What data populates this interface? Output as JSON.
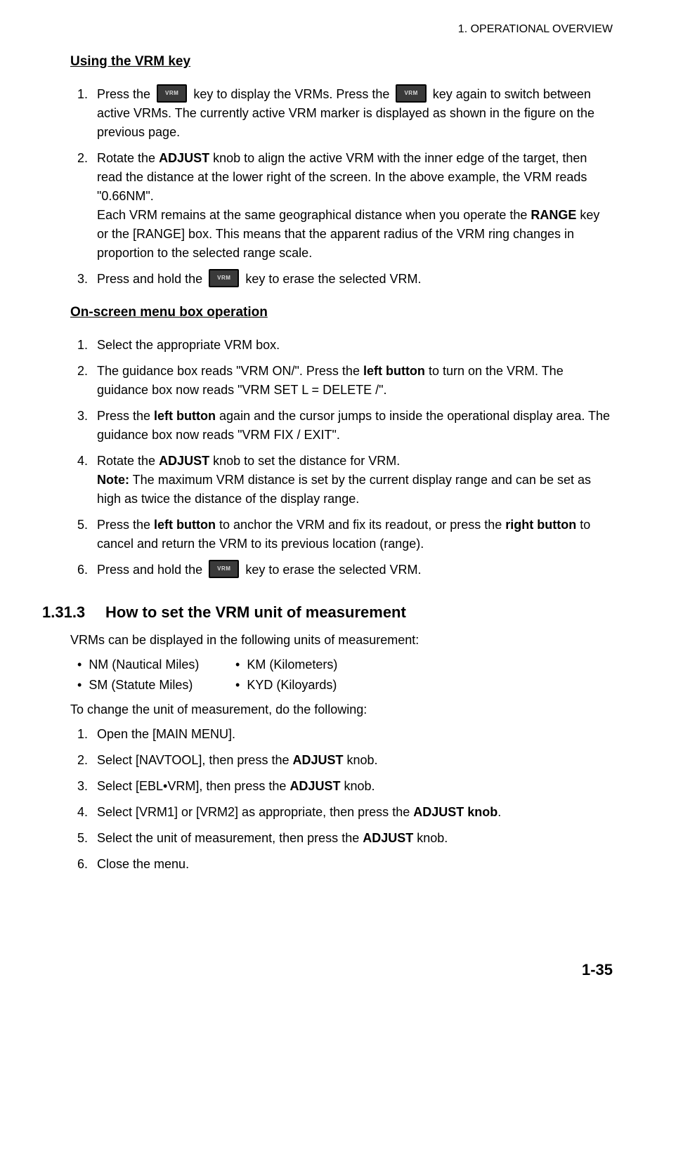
{
  "header": "1.  OPERATIONAL OVERVIEW",
  "section1_title": "Using the VRM key",
  "vrm_label": "VRM",
  "s1_1_a": "Press the ",
  "s1_1_b": " key to display the VRMs. Press the ",
  "s1_1_c": " key again to switch between active VRMs. The currently active VRM marker is displayed as shown in the figure on the previous page.",
  "s1_2_a": "Rotate the ",
  "s1_2_bold1": "ADJUST",
  "s1_2_b": " knob to align the active VRM with the inner edge of the target, then read the distance at the lower right of the screen. In the above example, the VRM reads \"0.66NM\".",
  "s1_2_c": "Each VRM remains at the same geographical distance when you operate the ",
  "s1_2_bold2": "RANGE",
  "s1_2_d": " key or the [RANGE] box. This means that the apparent radius of the VRM ring changes in proportion to the selected range scale.",
  "s1_3_a": "Press and hold the ",
  "s1_3_b": " key to erase the selected VRM.",
  "section2_title": "On-screen menu box operation",
  "s2_1": "Select the appropriate VRM box.",
  "s2_2_a": "The guidance box reads \"VRM ON/\". Press the ",
  "s2_2_bold": "left button",
  "s2_2_b": " to turn on the VRM. The guidance box now reads \"VRM SET L = DELETE /\".",
  "s2_3_a": "Press the ",
  "s2_3_bold": "left button",
  "s2_3_b": " again and the cursor jumps to inside the operational display area. The guidance box now reads \"VRM FIX / EXIT\".",
  "s2_4_a": "Rotate the ",
  "s2_4_bold": "ADJUST",
  "s2_4_b": " knob to set the distance for VRM.",
  "s2_4_note_bold": "Note:",
  "s2_4_note": " The maximum VRM distance is set by the current display range and can be set as high as twice the distance of the display range.",
  "s2_5_a": "Press the ",
  "s2_5_bold1": "left button",
  "s2_5_b": " to anchor the VRM and fix its readout, or press the ",
  "s2_5_bold2": "right button",
  "s2_5_c": " to cancel and return the VRM to its previous location (range).",
  "s2_6_a": "Press and hold the ",
  "s2_6_b": " key to erase the selected VRM.",
  "section3_num": "1.31.3",
  "section3_title": "How to set the VRM unit of measurement",
  "s3_intro": "VRMs can be displayed in the following units of measurement:",
  "bullets": {
    "nm": "NM (Nautical Miles)",
    "km": "KM (Kilometers)",
    "sm": "SM (Statute Miles)",
    "kyd": "KYD (Kiloyards)"
  },
  "s3_change": "To change the unit of measurement, do the following:",
  "s3_1": "Open the [MAIN MENU].",
  "s3_2_a": "Select [NAVTOOL], then press the ",
  "s3_2_bold": "ADJUST",
  "s3_2_b": " knob.",
  "s3_3_a": "Select [EBL•VRM], then press the ",
  "s3_3_bold": "ADJUST",
  "s3_3_b": " knob.",
  "s3_4_a": "Select [VRM1] or [VRM2] as appropriate, then press the ",
  "s3_4_bold": "ADJUST knob",
  "s3_4_b": ".",
  "s3_5_a": "Select the unit of measurement, then press the ",
  "s3_5_bold": "ADJUST",
  "s3_5_b": " knob.",
  "s3_6": "Close the menu.",
  "page_num": "1-35"
}
